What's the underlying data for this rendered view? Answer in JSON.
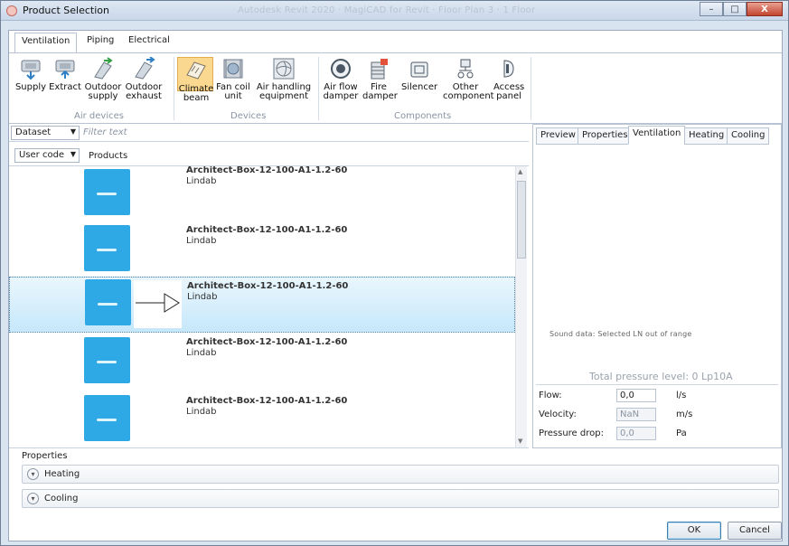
{
  "window": {
    "title": "Product Selection",
    "ghost_title": "Autodesk Revit 2020 · MagiCAD for Revit · Floor Plan 3 · 1 Floor",
    "controls": [
      "–",
      "□",
      "X"
    ]
  },
  "ribbon": {
    "tabs": [
      "Ventilation",
      "Piping",
      "Electrical"
    ],
    "active_tab": "Ventilation",
    "groups": [
      {
        "label": "Air devices",
        "buttons": [
          {
            "label": "Supply",
            "icon": "supply-device-icon"
          },
          {
            "label": "Extract",
            "icon": "extract-device-icon"
          },
          {
            "label": "Outdoor supply",
            "icon": "outdoor-supply-icon"
          },
          {
            "label": "Outdoor exhaust",
            "icon": "outdoor-exhaust-icon"
          }
        ]
      },
      {
        "label": "Devices",
        "buttons": [
          {
            "label": "Climate beam",
            "icon": "climate-beam-icon",
            "selected": true
          },
          {
            "label": "Fan coil unit",
            "icon": "fan-coil-icon"
          },
          {
            "label": "Air handling equipment",
            "icon": "air-handling-icon"
          }
        ]
      },
      {
        "label": "Components",
        "buttons": [
          {
            "label": "Air flow damper",
            "icon": "air-flow-damper-icon"
          },
          {
            "label": "Fire damper",
            "icon": "fire-damper-icon"
          },
          {
            "label": "Silencer",
            "icon": "silencer-icon"
          },
          {
            "label": "Other component",
            "icon": "other-component-icon"
          },
          {
            "label": "Access panel",
            "icon": "access-panel-icon"
          }
        ]
      }
    ]
  },
  "filter": {
    "dataset": "Dataset",
    "placeholder": "Filter text",
    "column_selector": "User code",
    "column_header": "Products"
  },
  "products": [
    {
      "name": "Architect-Box-12-100-A1-1.2-60",
      "maker": "Lindab"
    },
    {
      "name": "Architect-Box-12-100-A1-1.2-60",
      "maker": "Lindab"
    },
    {
      "name": "Architect-Box-12-100-A1-1.2-60",
      "maker": "Lindab",
      "selected": true
    },
    {
      "name": "Architect-Box-12-100-A1-1.2-60",
      "maker": "Lindab"
    },
    {
      "name": "Architect-Box-12-100-A1-1.2-60",
      "maker": "Lindab"
    }
  ],
  "right_panel": {
    "tabs": [
      "Preview",
      "Properties",
      "Ventilation",
      "Heating",
      "Cooling"
    ],
    "active_tab": "Ventilation",
    "sound_note": "Sound data: Selected LN out of range",
    "total_pressure": "Total pressure level: 0 Lp10A",
    "fields": [
      {
        "label": "Flow:",
        "value": "0,0",
        "unit": "l/s",
        "disabled": false
      },
      {
        "label": "Velocity:",
        "value": "NaN",
        "unit": "m/s",
        "disabled": true
      },
      {
        "label": "Pressure drop:",
        "value": "0,0",
        "unit": "Pa",
        "disabled": true
      }
    ]
  },
  "properties": {
    "label": "Properties",
    "sections": [
      "Heating",
      "Cooling"
    ]
  },
  "buttons": {
    "ok": "OK",
    "cancel": "Cancel"
  }
}
